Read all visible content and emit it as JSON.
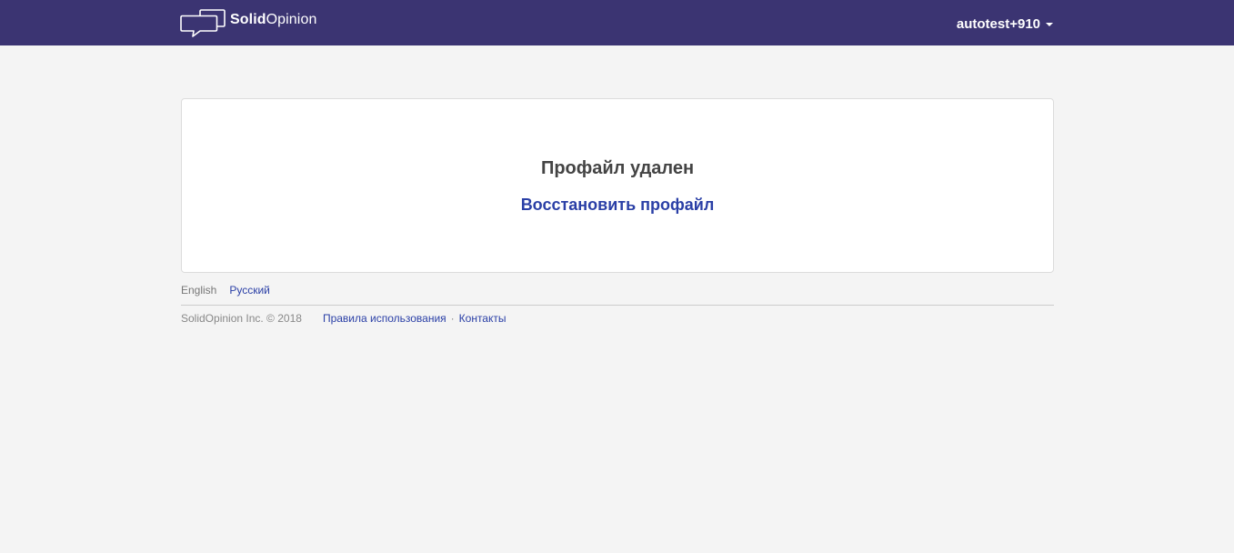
{
  "header": {
    "logo_solid": "Solid",
    "logo_opinion": "Opinion",
    "user_name": "autotest+910"
  },
  "colors": {
    "navbar": "#3b3472",
    "link": "#2a3fa6",
    "background": "#f4f4f4"
  },
  "icons": {
    "logo": "speech-bubble-icon",
    "user_menu": "caret-down-icon"
  },
  "main": {
    "title": "Профайл удален",
    "restore_link": "Восстановить профайл"
  },
  "footer": {
    "languages": {
      "current": "English",
      "other": "Русский"
    },
    "copyright": "SolidOpinion Inc. © 2018",
    "terms_link": "Правила использования",
    "separator": "·",
    "contacts_link": "Контакты"
  }
}
